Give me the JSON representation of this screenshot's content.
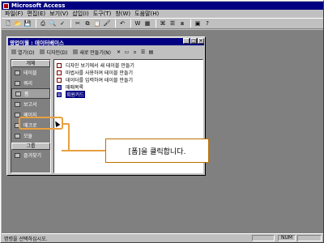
{
  "app": {
    "title": "Microsoft Access"
  },
  "menu": [
    "파일(F)",
    "편집(E)",
    "보기(V)",
    "삽입(I)",
    "도구(T)",
    "창(W)",
    "도움말(H)"
  ],
  "toolbar": {
    "icons": [
      "new-icon",
      "open-icon",
      "save-icon",
      "print-icon",
      "preview-icon",
      "spell-icon",
      "cut-icon",
      "copy-icon",
      "paste-icon",
      "format-painter-icon",
      "undo-icon",
      "office-links-icon",
      "analyze-icon",
      "code-icon",
      "properties-icon",
      "relationships-icon",
      "new-object-icon",
      "help-icon"
    ]
  },
  "dbwindow": {
    "title": "영업이월 : 데이터베이스",
    "toolbar": {
      "open": "열기(O)",
      "design": "디자인(D)",
      "new": "새로 만들기(N)"
    },
    "objects_header": "개체",
    "objects": [
      {
        "label": "테이블",
        "icon": "table-icon"
      },
      {
        "label": "쿼리",
        "icon": "query-icon"
      },
      {
        "label": "폼",
        "icon": "form-icon"
      },
      {
        "label": "보고서",
        "icon": "report-icon"
      },
      {
        "label": "페이지",
        "icon": "page-icon"
      },
      {
        "label": "매크로",
        "icon": "macro-icon"
      },
      {
        "label": "모듈",
        "icon": "module-icon"
      }
    ],
    "groups_header": "그룹",
    "groups": [
      {
        "label": "즐겨찾기",
        "icon": "favorites-icon"
      }
    ],
    "list": [
      {
        "label": "디자인 보기에서 새 테이블 만들기",
        "icon": "wizard-icon"
      },
      {
        "label": "마법사를 사용하여 테이블 만들기",
        "icon": "wizard-icon"
      },
      {
        "label": "데이터를 입력하여 테이블 만들기",
        "icon": "wizard-icon"
      },
      {
        "label": "매매목록",
        "icon": "form-item-icon"
      },
      {
        "label": "회원카드",
        "icon": "form-item-icon"
      }
    ]
  },
  "callout": {
    "text": "[폼]을 클릭합니다."
  },
  "status": {
    "text": "명령을 선택하십시오.",
    "num": "NUM"
  }
}
